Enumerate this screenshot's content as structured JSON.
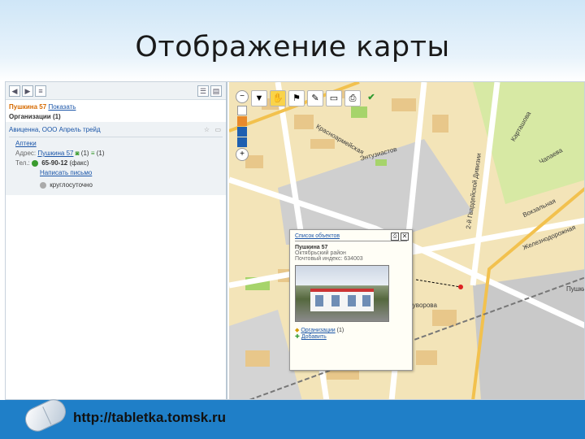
{
  "slide": {
    "title": "Отображение карты"
  },
  "footer": {
    "url": "http://tabletka.tomsk.ru"
  },
  "panel": {
    "header_address": "Пушкина 57",
    "header_action": "Показать",
    "orgs_label": "Организации (1)",
    "org_name": "Авиценна, ООО Апрель трейд",
    "category": "Аптеки",
    "addr_label": "Адрес:",
    "addr_value": "Пушкина 57",
    "addr_count": "(1)",
    "addr_count2": "(1)",
    "phone_label": "Тел.:",
    "phone_value": "65-90-12",
    "phone_note": "(факс)",
    "write_letter": "Написать письмо",
    "hours": "круглосуточно"
  },
  "popup": {
    "title": "Список объектов",
    "address": "Пушкина 57",
    "district": "Октябрьский район",
    "postal": "Почтовый индекс: 634003",
    "orgs": "Организации",
    "orgs_count": "(1)",
    "add": "Добавить"
  },
  "map_labels": {
    "street1": "Вокзальная",
    "street2": "Красноармейская",
    "street3": "Железнодорожная",
    "street4": "Пушкина",
    "street5": "Энтузиастов",
    "street6": "2-й Гвардейской Дивизии",
    "street7": "Суворова",
    "street8": "Карташова",
    "street9": "Чапаева"
  },
  "colors": {
    "accent": "#d66a00",
    "footer": "#1f7fc8",
    "map_bg": "#f3e4b8"
  }
}
